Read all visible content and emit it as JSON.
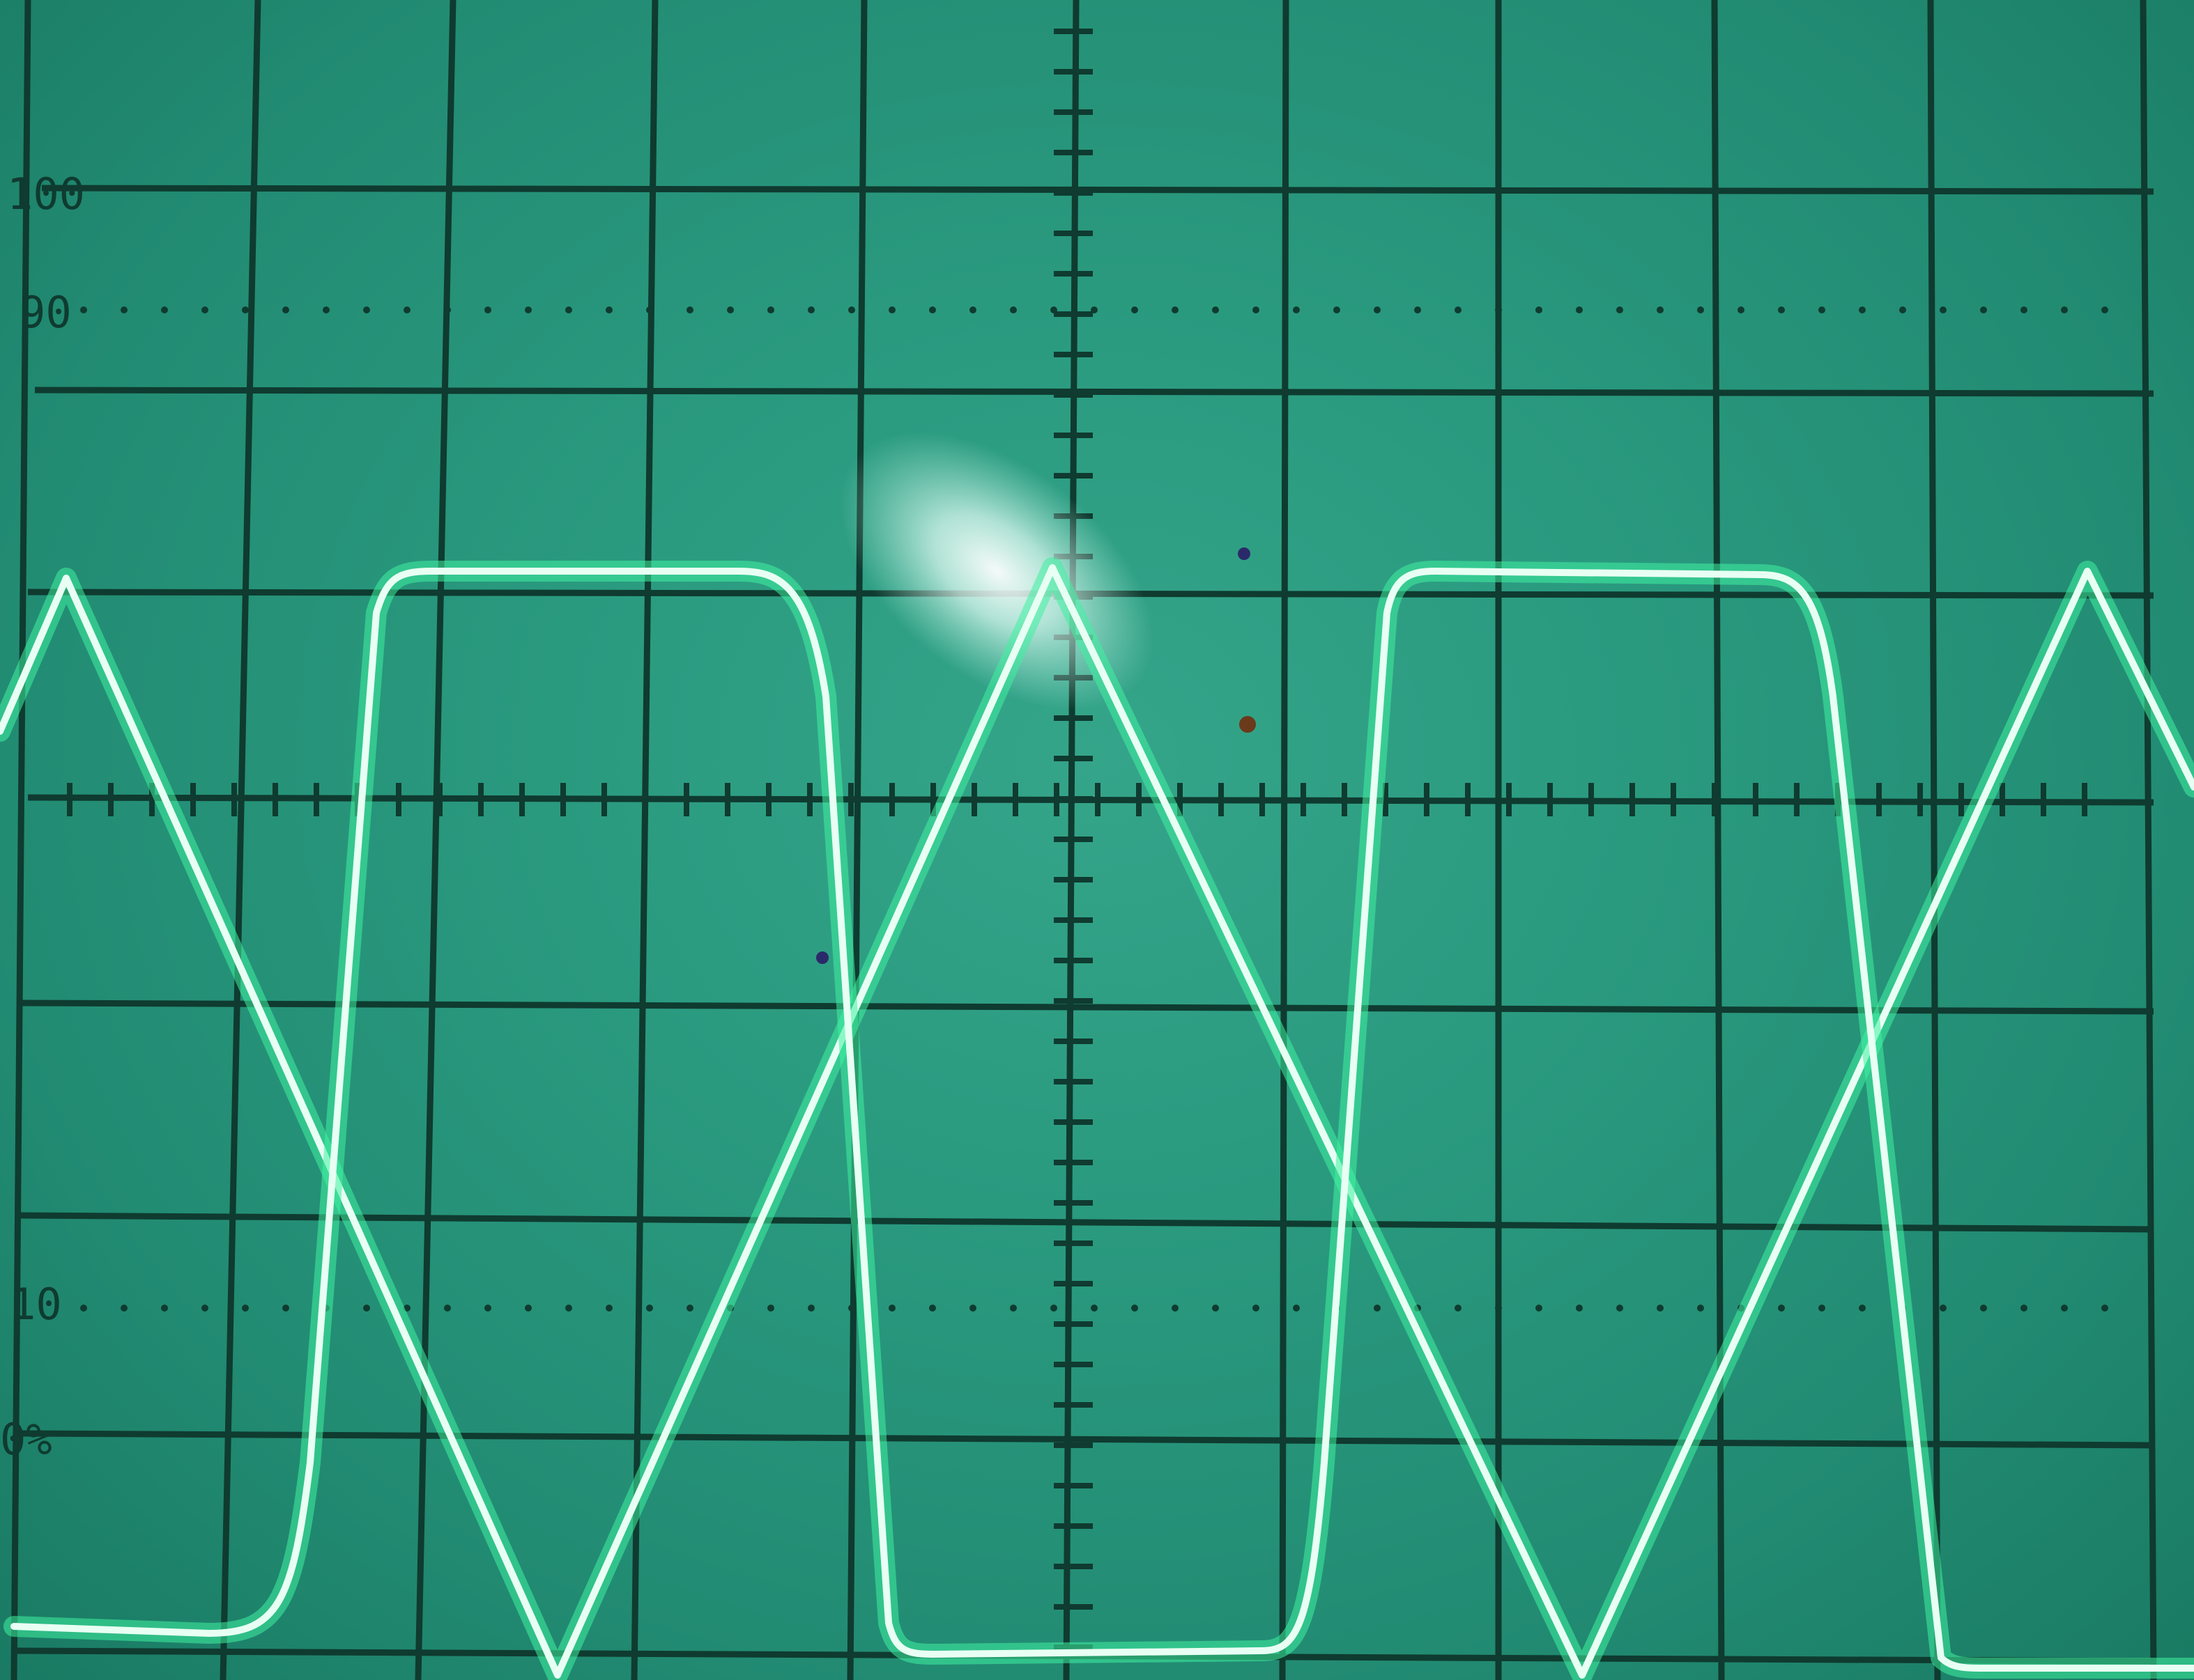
{
  "scale_labels": {
    "top": "100",
    "high": "90",
    "low": "10",
    "bottom": "0%"
  },
  "colors": {
    "screen": "#2a9a7f",
    "graticule": "#0f3b30",
    "trace": "#e8fff4",
    "trace_glow": "#40f0a0"
  }
}
